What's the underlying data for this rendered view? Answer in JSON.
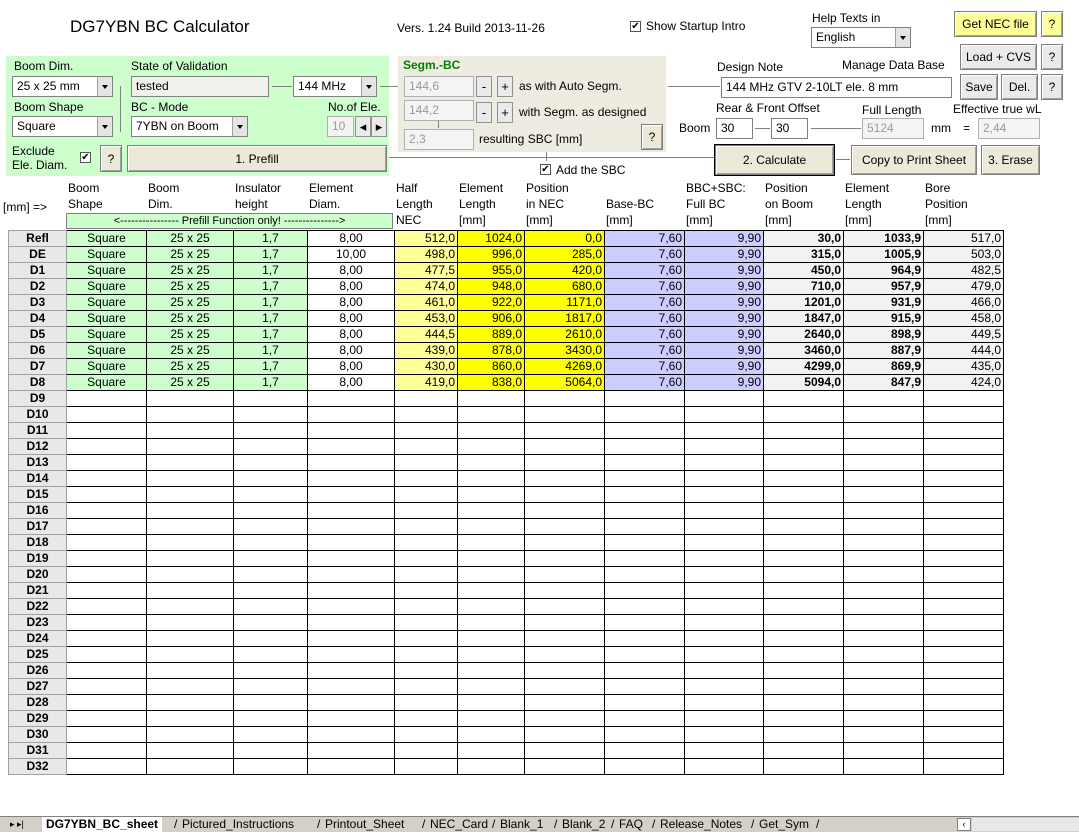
{
  "header": {
    "title": "DG7YBN BC Calculator",
    "version": "Vers. 1.24  Build 2013-11-26",
    "show_intro_label": "Show Startup Intro",
    "show_intro_checked": "✔",
    "help_texts_label": "Help Texts in",
    "language": "English"
  },
  "buttons": {
    "get_nec": "Get NEC file",
    "load_cvs": "Load + CVS",
    "save": "Save",
    "del": "Del.",
    "help": "?",
    "prefill": "1. Prefill",
    "calculate": "2. Calculate",
    "copy_print": "Copy to Print Sheet",
    "erase": "3. Erase"
  },
  "left_panel": {
    "boom_dim_label": "Boom Dim.",
    "boom_dim_value": "25 x 25 mm",
    "state_label": "State of Validation",
    "state_value": "tested",
    "band_value": "144 MHz",
    "boom_shape_label": "Boom Shape",
    "boom_shape_value": "Square",
    "bc_mode_label": "BC - Mode",
    "bc_mode_value": "7YBN on Boom",
    "no_ele_label": "No.of Ele.",
    "no_ele_value": "10",
    "exclude_label": "Exclude\nEle. Diam.",
    "exclude_checked": "✔"
  },
  "segm_panel": {
    "title": "Segm.-BC",
    "auto_value": "144,6",
    "auto_label": "as with Auto Segm.",
    "designed_value": "144,2",
    "designed_label": "with Segm. as designed",
    "result_value": "2,3",
    "result_label": "resulting SBC [mm]",
    "add_sbc_label": "Add the SBC",
    "add_sbc_checked": "✔",
    "minus": "-",
    "plus": "+"
  },
  "right_panel": {
    "design_note_label": "Design Note",
    "manage_db_label": "Manage Data Base",
    "design_note_value": "144 MHz  GTV  2-10LT ele. 8 mm",
    "offset_label": "Rear & Front Offset",
    "full_length_label": "Full Length",
    "eff_wl_label": "Effective true wL",
    "boom_label": "Boom",
    "rear_offset": "30",
    "front_offset": "30",
    "full_length": "5124",
    "mm_label": "mm",
    "eq_label": "=",
    "eff_wl": "2,44"
  },
  "table": {
    "unit_label": "[mm] =>",
    "prefill_note": "<---------------- Prefill Function only! --------------->",
    "headers": [
      "Boom\nShape",
      "Boom\nDim.",
      "Insulator\nheight",
      "Element\nDiam.",
      "Half\nLength\nNEC",
      "Element\nLength\n[mm]",
      "Position\nin NEC\n[mm]",
      "\nBase-BC\n[mm]",
      "BBC+SBC:\nFull BC\n[mm]",
      "Position\non Boom\n[mm]",
      "Element\nLength\n[mm]",
      "Bore\nPosition\n[mm]"
    ],
    "rows": [
      {
        "label": "Refl",
        "shape": "Square",
        "dim": "25 x 25",
        "ins": "1,7",
        "diam": "8,00",
        "half": "512,0",
        "len": "1024,0",
        "pos": "0,0",
        "bbc": "7,60",
        "full": "9,90",
        "boom": "30,0",
        "elen": "1033,9",
        "bore": "517,0"
      },
      {
        "label": "DE",
        "shape": "Square",
        "dim": "25 x 25",
        "ins": "1,7",
        "diam": "10,00",
        "half": "498,0",
        "len": "996,0",
        "pos": "285,0",
        "bbc": "7,60",
        "full": "9,90",
        "boom": "315,0",
        "elen": "1005,9",
        "bore": "503,0"
      },
      {
        "label": "D1",
        "shape": "Square",
        "dim": "25 x 25",
        "ins": "1,7",
        "diam": "8,00",
        "half": "477,5",
        "len": "955,0",
        "pos": "420,0",
        "bbc": "7,60",
        "full": "9,90",
        "boom": "450,0",
        "elen": "964,9",
        "bore": "482,5"
      },
      {
        "label": "D2",
        "shape": "Square",
        "dim": "25 x 25",
        "ins": "1,7",
        "diam": "8,00",
        "half": "474,0",
        "len": "948,0",
        "pos": "680,0",
        "bbc": "7,60",
        "full": "9,90",
        "boom": "710,0",
        "elen": "957,9",
        "bore": "479,0"
      },
      {
        "label": "D3",
        "shape": "Square",
        "dim": "25 x 25",
        "ins": "1,7",
        "diam": "8,00",
        "half": "461,0",
        "len": "922,0",
        "pos": "1171,0",
        "bbc": "7,60",
        "full": "9,90",
        "boom": "1201,0",
        "elen": "931,9",
        "bore": "466,0"
      },
      {
        "label": "D4",
        "shape": "Square",
        "dim": "25 x 25",
        "ins": "1,7",
        "diam": "8,00",
        "half": "453,0",
        "len": "906,0",
        "pos": "1817,0",
        "bbc": "7,60",
        "full": "9,90",
        "boom": "1847,0",
        "elen": "915,9",
        "bore": "458,0"
      },
      {
        "label": "D5",
        "shape": "Square",
        "dim": "25 x 25",
        "ins": "1,7",
        "diam": "8,00",
        "half": "444,5",
        "len": "889,0",
        "pos": "2610,0",
        "bbc": "7,60",
        "full": "9,90",
        "boom": "2640,0",
        "elen": "898,9",
        "bore": "449,5"
      },
      {
        "label": "D6",
        "shape": "Square",
        "dim": "25 x 25",
        "ins": "1,7",
        "diam": "8,00",
        "half": "439,0",
        "len": "878,0",
        "pos": "3430,0",
        "bbc": "7,60",
        "full": "9,90",
        "boom": "3460,0",
        "elen": "887,9",
        "bore": "444,0"
      },
      {
        "label": "D7",
        "shape": "Square",
        "dim": "25 x 25",
        "ins": "1,7",
        "diam": "8,00",
        "half": "430,0",
        "len": "860,0",
        "pos": "4269,0",
        "bbc": "7,60",
        "full": "9,90",
        "boom": "4299,0",
        "elen": "869,9",
        "bore": "435,0"
      },
      {
        "label": "D8",
        "shape": "Square",
        "dim": "25 x 25",
        "ins": "1,7",
        "diam": "8,00",
        "half": "419,0",
        "len": "838,0",
        "pos": "5064,0",
        "bbc": "7,60",
        "full": "9,90",
        "boom": "5094,0",
        "elen": "847,9",
        "bore": "424,0"
      }
    ],
    "empty_rows": [
      "D9",
      "D10",
      "D11",
      "D12",
      "D13",
      "D14",
      "D15",
      "D16",
      "D17",
      "D18",
      "D19",
      "D20",
      "D21",
      "D22",
      "D23",
      "D24",
      "D25",
      "D26",
      "D27",
      "D28",
      "D29",
      "D30",
      "D31",
      "D32"
    ]
  },
  "sheet_tabs": [
    "DG7YBN_BC_sheet",
    "Pictured_Instructions",
    "Printout_Sheet",
    "NEC_Card",
    "Blank_1",
    "Blank_2",
    "FAQ",
    "Release_Notes",
    "Get_Sym"
  ],
  "colors": {
    "green": "#ccffcc",
    "yellow": "#ffff00",
    "light_yellow": "#ffff99",
    "blue": "#ccccff"
  }
}
